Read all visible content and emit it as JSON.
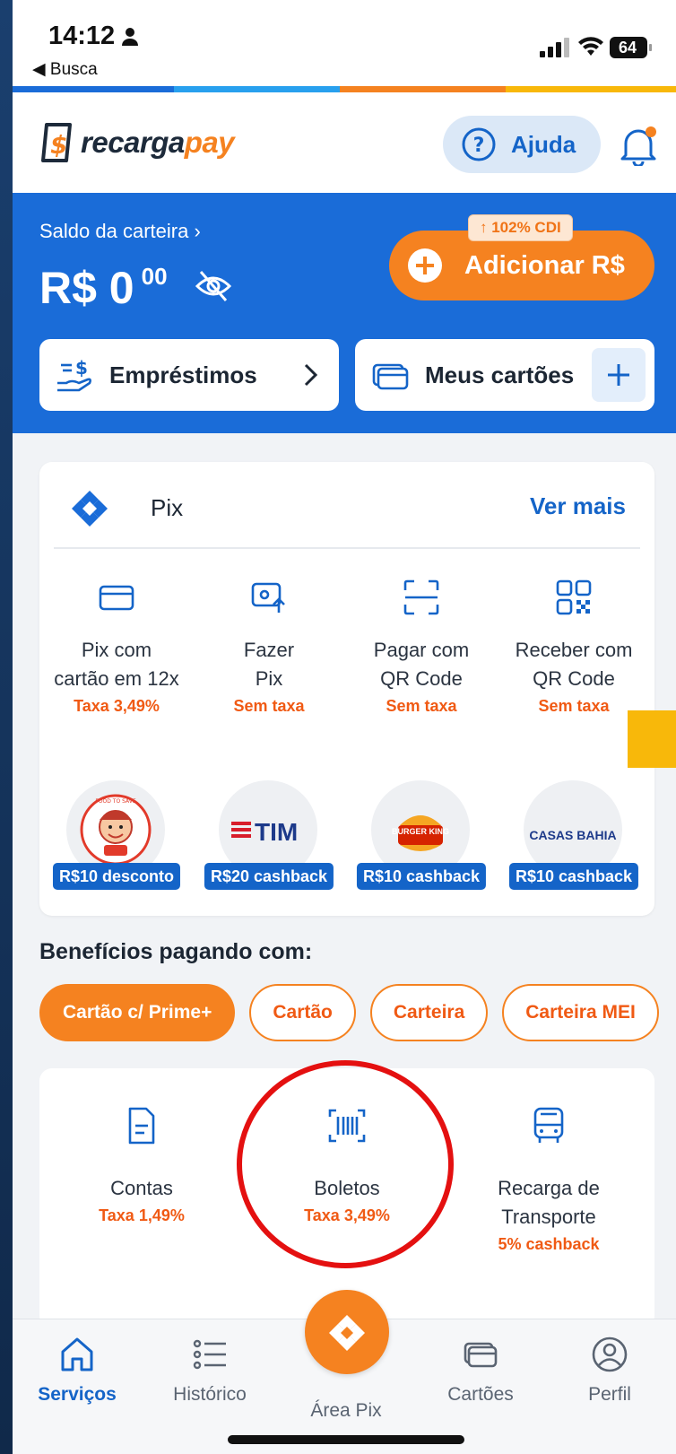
{
  "status_bar": {
    "time": "14:12",
    "back_label": "◀ Busca",
    "battery": "64"
  },
  "header": {
    "logo_part1": "recarga",
    "logo_part2": "pay",
    "help_label": "Ajuda"
  },
  "wallet": {
    "balance_label": "Saldo da carteira",
    "balance_main": "R$ 0",
    "balance_cents": "00",
    "cdi_badge": "↑ 102% CDI",
    "add_button": "Adicionar R$",
    "loans_label": "Empréstimos",
    "cards_label": "Meus cartões"
  },
  "pix": {
    "title": "Pix",
    "see_more": "Ver mais",
    "actions": [
      {
        "label": "Pix com\ncartão em 12x",
        "fee": "Taxa 3,49%",
        "icon": "credit-card-icon"
      },
      {
        "label": "Fazer\nPix",
        "fee": "Sem taxa",
        "icon": "send-pix-icon"
      },
      {
        "label": "Pagar com\nQR Code",
        "fee": "Sem taxa",
        "icon": "scan-qr-icon"
      },
      {
        "label": "Receber com\nQR Code",
        "fee": "Sem taxa",
        "icon": "qr-code-icon"
      }
    ],
    "partners": [
      {
        "logo_text": "FOOD TO SAVE",
        "badge": "R$10 desconto"
      },
      {
        "logo_text": "TIM",
        "badge": "R$20 cashback"
      },
      {
        "logo_text": "BURGER KING",
        "badge": "R$10 cashback"
      },
      {
        "logo_text": "CASAS BAHIA",
        "badge": "R$10 cashback"
      }
    ]
  },
  "benefits": {
    "title": "Benefícios pagando com:",
    "chips": [
      "Cartão c/ Prime+",
      "Cartão",
      "Carteira",
      "Carteira MEI"
    ],
    "active_chip": "Cartão c/ Prime+"
  },
  "services": [
    {
      "label": "Contas",
      "fee": "Taxa 1,49%",
      "icon": "bill-document-icon"
    },
    {
      "label": "Boletos",
      "fee": "Taxa 3,49%",
      "icon": "barcode-icon"
    },
    {
      "label": "Recarga de\nTransporte",
      "fee": "5% cashback",
      "icon": "bus-icon"
    }
  ],
  "bottom_nav": [
    {
      "label": "Serviços",
      "icon": "home-icon",
      "active": true
    },
    {
      "label": "Histórico",
      "icon": "list-icon",
      "active": false
    },
    {
      "label": "Área Pix",
      "icon": "pix-icon",
      "active": false
    },
    {
      "label": "Cartões",
      "icon": "cards-icon",
      "active": false
    },
    {
      "label": "Perfil",
      "icon": "profile-icon",
      "active": false
    }
  ],
  "colors": {
    "brand_blue": "#1a6cd8",
    "brand_orange": "#f58220",
    "fee_orange": "#f05a14",
    "link_blue": "#1464c8",
    "annotation_red": "#e41010"
  }
}
